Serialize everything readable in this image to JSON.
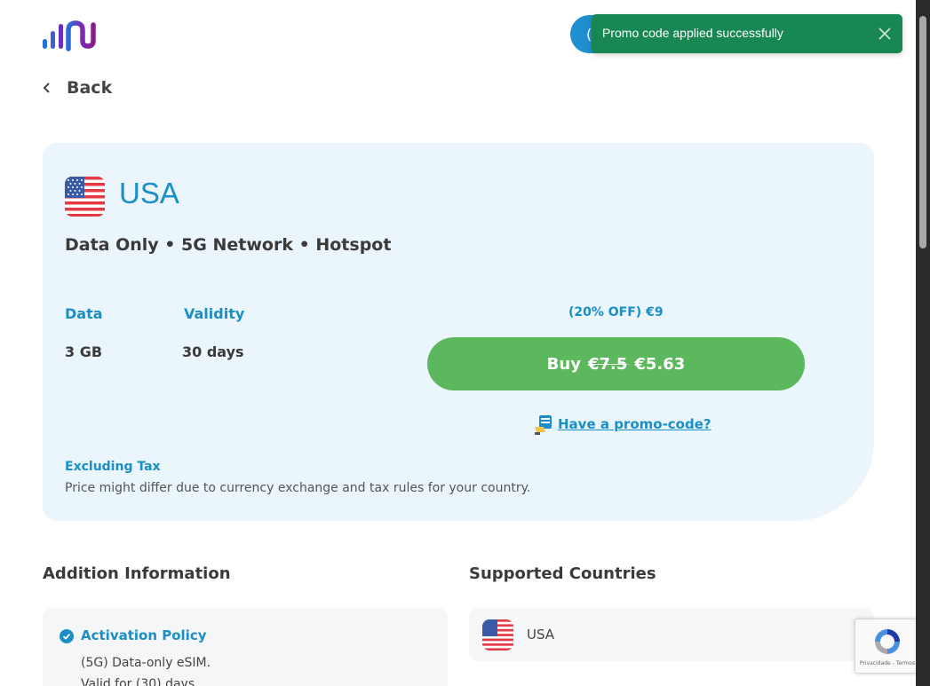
{
  "toast": {
    "message": "Promo code applied successfully"
  },
  "nav": {
    "back_label": "Back"
  },
  "plan": {
    "country": "USA",
    "features": "Data Only • 5G Network • Hotspot",
    "data_label": "Data",
    "data_value": "3 GB",
    "validity_label": "Validity",
    "validity_value": "30 days",
    "discount_text": "(20% OFF)  €9",
    "buy_prefix": "Buy",
    "old_price": "€7.5",
    "new_price": "€5.63",
    "promo_link": "Have a promo-code?",
    "tax_title": "Excluding Tax",
    "tax_note": "Price might differ due to currency exchange and tax rules for your country."
  },
  "sections": {
    "additional_title": "Addition Information",
    "supported_title": "Supported Countries"
  },
  "activation": {
    "title": "Activation Policy",
    "lines": [
      "(5G) Data-only eSIM.",
      "Valid for (30) days."
    ]
  },
  "supported_countries": [
    {
      "name": "USA"
    }
  ],
  "recaptcha": {
    "terms": "Privacidade - Termos"
  },
  "colors": {
    "accent": "#1a8ec6",
    "buy": "#5cb85c",
    "toast": "#198754",
    "card": "#eaf5fc"
  }
}
